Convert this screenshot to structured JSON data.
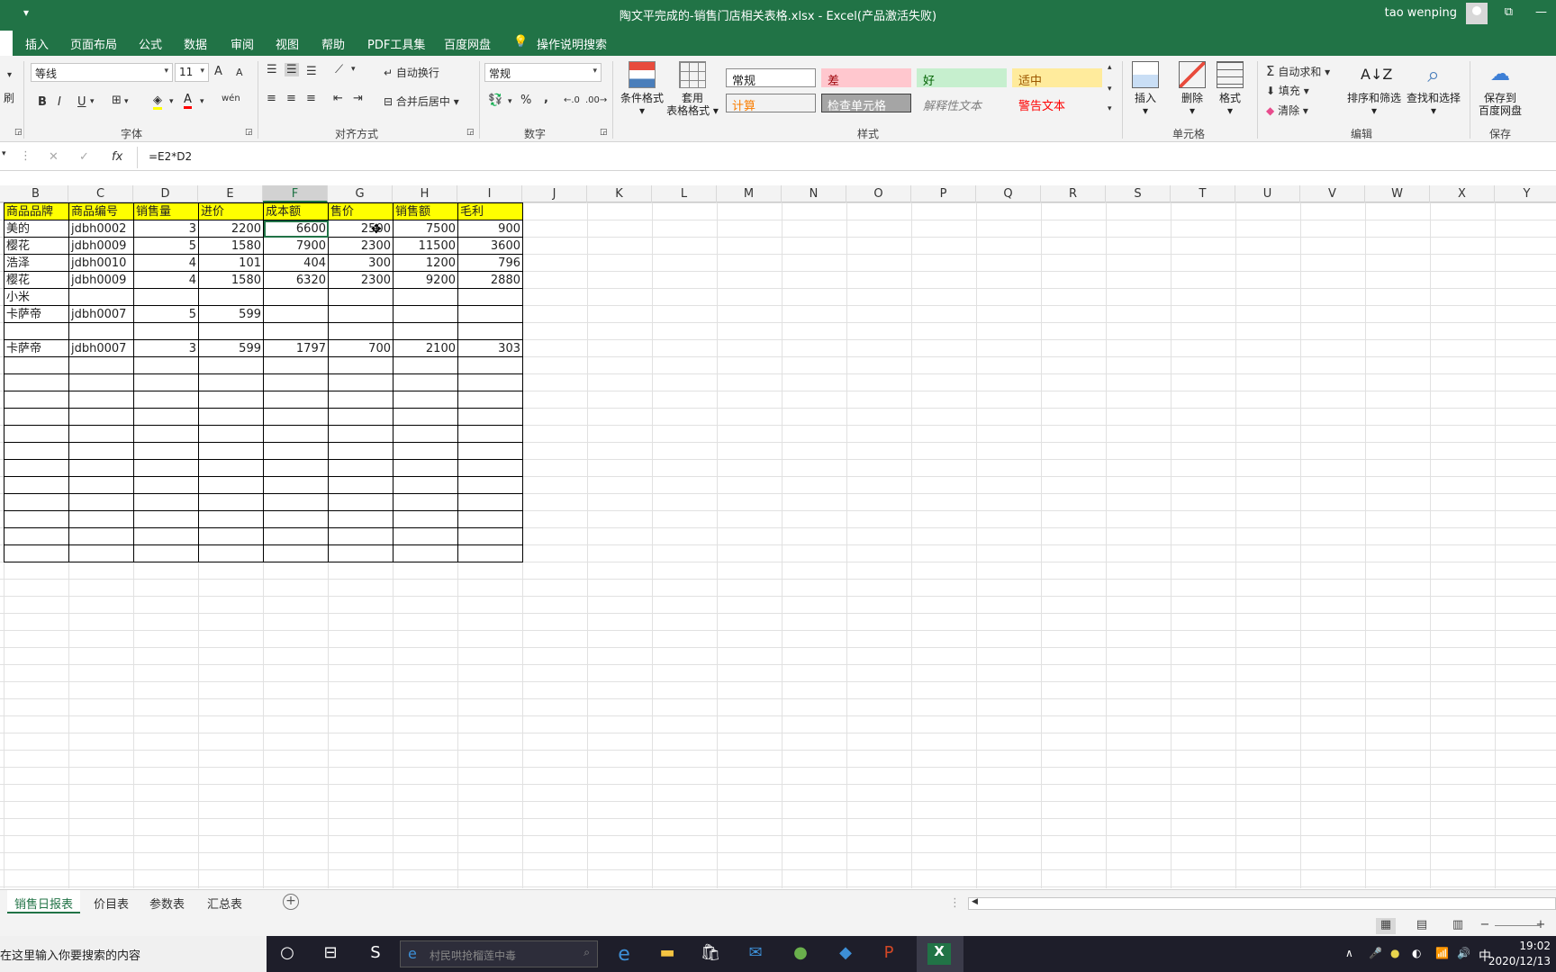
{
  "window": {
    "title": "陶文平完成的-销售门店相关表格.xlsx  -  Excel(产品激活失败)",
    "user": "tao wenping"
  },
  "menu": [
    "插入",
    "页面布局",
    "公式",
    "数据",
    "审阅",
    "视图",
    "帮助",
    "PDF工具集",
    "百度网盘",
    "操作说明搜索"
  ],
  "ribbon": {
    "clipboard_fragment": "刷",
    "font": {
      "name": "等线",
      "size": "11",
      "grow": "A",
      "shrink": "A",
      "bold": "B",
      "italic": "I",
      "underline": "U",
      "wen": "wén",
      "label": "字体"
    },
    "alignment": {
      "wrap": "自动换行",
      "merge": "合并后居中",
      "label": "对齐方式"
    },
    "number": {
      "format": "常规",
      "percent": "%",
      "comma": ",",
      "label": "数字"
    },
    "styles": {
      "conditional": "条件格式",
      "table_format_1": "套用",
      "table_format_2": "表格格式",
      "cells": [
        {
          "text": "常规",
          "bg": "#ffffff",
          "color": "#222222",
          "border": "#8c8c8c"
        },
        {
          "text": "差",
          "bg": "#ffc7ce",
          "color": "#9c0006",
          "border": "transparent"
        },
        {
          "text": "好",
          "bg": "#c6efce",
          "color": "#006100",
          "border": "transparent"
        },
        {
          "text": "适中",
          "bg": "#ffeb9c",
          "color": "#9c5700",
          "border": "transparent"
        },
        {
          "text": "计算",
          "bg": "#f2f2f2",
          "color": "#fa7d00",
          "border": "#7f7f7f"
        },
        {
          "text": "检查单元格",
          "bg": "#a5a5a5",
          "color": "#ffffff",
          "border": "#3f3f3f"
        },
        {
          "text": "解释性文本",
          "bg": "#f3f3f3",
          "color": "#7f7f7f",
          "border": "transparent"
        },
        {
          "text": "警告文本",
          "bg": "#f3f3f3",
          "color": "#ff0000",
          "border": "transparent"
        }
      ],
      "label": "样式"
    },
    "cells_group": {
      "insert": "插入",
      "delete": "删除",
      "format": "格式",
      "label": "单元格"
    },
    "editing": {
      "autosum": "自动求和",
      "fill": "填充",
      "clear": "清除",
      "sort": "排序和筛选",
      "find": "查找和选择",
      "label": "编辑"
    },
    "save": {
      "line1": "保存到",
      "line2": "百度网盘",
      "label": "保存"
    }
  },
  "formula": {
    "fx": "fx",
    "value": "=E2*D2"
  },
  "columns": [
    "B",
    "C",
    "D",
    "E",
    "F",
    "G",
    "H",
    "I",
    "J",
    "K",
    "L",
    "M",
    "N",
    "O",
    "P",
    "Q",
    "R",
    "S",
    "T",
    "U",
    "V",
    "W",
    "X",
    "Y"
  ],
  "selected_column": "F",
  "table": {
    "header": [
      "商品品牌",
      "商品编号",
      "销售量",
      "进价",
      "成本额",
      "售价",
      "销售额",
      "毛利"
    ],
    "rows": [
      [
        "美的",
        "jdbh0002",
        "3",
        "2200",
        "6600",
        "2500",
        "7500",
        "900"
      ],
      [
        "樱花",
        "jdbh0009",
        "5",
        "1580",
        "7900",
        "2300",
        "11500",
        "3600"
      ],
      [
        "浩泽",
        "jdbh0010",
        "4",
        "101",
        "404",
        "300",
        "1200",
        "796"
      ],
      [
        "樱花",
        "jdbh0009",
        "4",
        "1580",
        "6320",
        "2300",
        "9200",
        "2880"
      ],
      [
        "小米",
        "",
        "",
        "",
        "",
        "",
        "",
        ""
      ],
      [
        "卡萨帝",
        "jdbh0007",
        "5",
        "599",
        "",
        "",
        "",
        ""
      ],
      [
        "",
        "",
        "",
        "",
        "",
        "",
        "",
        ""
      ],
      [
        "卡萨帝",
        "jdbh0007",
        "3",
        "599",
        "1797",
        "700",
        "2100",
        "303"
      ]
    ],
    "empty_rows": 12
  },
  "sheets": [
    "销售日报表",
    "价目表",
    "参数表",
    "汇总表"
  ],
  "active_sheet": 0,
  "taskbar": {
    "search_placeholder": "在这里输入你要搜索的内容",
    "browser_search": "村民哄抢榴莲中毒",
    "ime": "中",
    "time": "19:02",
    "date": "2020/12/13"
  }
}
